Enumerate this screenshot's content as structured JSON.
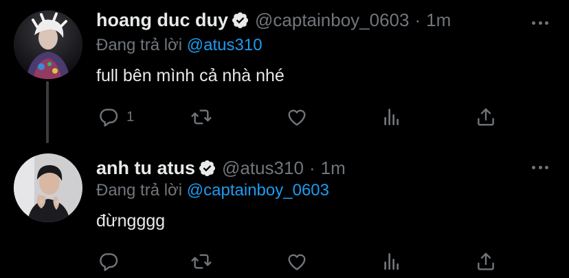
{
  "tweets": [
    {
      "name": "hoang duc duy",
      "handle": "@captainboy_0603",
      "separator": "·",
      "time": "1m",
      "replying_prefix": "Đang trả lời",
      "replying_to": "@atus310",
      "text": "full bên mình cả nhà nhé",
      "reply_count": "1"
    },
    {
      "name": "anh tu atus",
      "handle": "@atus310",
      "separator": "·",
      "time": "1m",
      "replying_prefix": "Đang trả lời",
      "replying_to": "@captainboy_0603",
      "text": "đừngggg",
      "reply_count": ""
    }
  ],
  "colors": {
    "background": "#000000",
    "text": "#e7e9ea",
    "muted": "#71767b",
    "accent": "#1d9bf0"
  },
  "icons": [
    "verified-badge-icon",
    "more-icon",
    "reply-icon",
    "retweet-icon",
    "like-icon",
    "stats-icon",
    "share-icon"
  ]
}
